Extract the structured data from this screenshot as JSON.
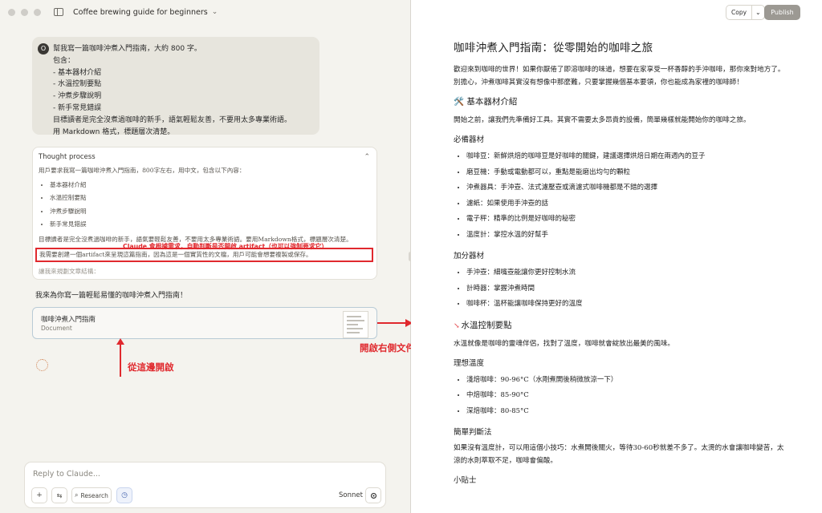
{
  "window": {
    "title": "Coffee brewing guide for beginners"
  },
  "chat": {
    "user_avatar": "O",
    "user_message_lines": [
      "幫我寫一篇咖啡沖煮入門指南，大約 800 字。",
      "包含：",
      "- 基本器材介紹",
      "- 水溫控制要點",
      "- 沖煮步驟說明",
      "- 新手常見錯誤",
      "目標讀者是完全沒煮過咖啡的新手，語氣輕鬆友善，不要用太多專業術語。",
      "用 Markdown 格式，標題層次清楚。"
    ],
    "thought_process": {
      "label": "Thought process",
      "intro": "用戶要求我寫一篇咖啡沖煮入門指南，800字左右，用中文，包含以下內容：",
      "items": [
        "基本器材介紹",
        "水溫控制要點",
        "沖煮步驟說明",
        "新手常見錯誤"
      ],
      "note": "目標讀者是完全沒煮過咖啡的新手，語氣要輕鬆友善，不要用太多專業術語。要用Markdown格式，標題層次清楚。",
      "highlighted": "我需要創建一個artifact來呈現這篇指南，因為這是一個實質性的文檔，用戶可能會想要複製或保存。",
      "faded": "讓我來規劃文章結構："
    },
    "assistant_reply": "我來為你寫一篇輕鬆易懂的咖啡沖煮入門指南！",
    "artifact_card": {
      "title": "咖啡沖煮入門指南",
      "type": "Document"
    },
    "composer": {
      "placeholder": "Reply to Claude...",
      "research_label": "Research",
      "model": "Sonnet 4"
    }
  },
  "annotations": {
    "auto_artifact": "Claude 會根據需求，自動判斷是否開啟 artifact（也可以強制要求它）",
    "open_from_here": "從這邊開啟",
    "open_right_panel": "開啟右側文件版面"
  },
  "toolbar": {
    "copy_label": "Copy",
    "publish_label": "Publish"
  },
  "document": {
    "title": "咖啡沖煮入門指南：從零開始的咖啡之旅",
    "intro": "歡迎來到咖啡的世界！如果你厭倦了即溶咖啡的味道，想要在家享受一杯香醇的手沖咖啡，那你來對地方了。別擔心，沖煮咖啡其實沒有想像中那麼難，只要掌握幾個基本要領，你也能成為家裡的咖啡師！",
    "section1": {
      "heading": "🛠️ 基本器材介紹",
      "intro": "開始之前，讓我們先準備好工具。其實不需要太多昂貴的設備，簡單幾樣就能開始你的咖啡之旅。",
      "sub1": {
        "heading": "必備器材",
        "items": [
          "咖啡豆：新鮮烘焙的咖啡豆是好咖啡的關鍵，建議選擇烘焙日期在兩週內的豆子",
          "磨豆機：手動或電動都可以，重點是能磨出均勻的顆粒",
          "沖煮器具：手沖壺、法式濾壓壺或滴濾式咖啡機都是不錯的選擇",
          "濾紙：如果使用手沖壺的話",
          "電子秤：精準的比例是好咖啡的秘密",
          "溫度計：掌控水溫的好幫手"
        ]
      },
      "sub2": {
        "heading": "加分器材",
        "items": [
          "手沖壺：細嘴壺能讓你更好控制水流",
          "計時器：掌握沖煮時間",
          "咖啡杯：溫杯能讓咖啡保持更好的溫度"
        ]
      }
    },
    "section2": {
      "heading": "水溫控制要點",
      "intro": "水溫就像是咖啡的靈魂伴侶，找對了溫度，咖啡就會綻放出最美的風味。",
      "sub1": {
        "heading": "理想溫度",
        "items": [
          "淺焙咖啡：90-96°C（水剛煮開後稍微放涼一下）",
          "中焙咖啡：85-90°C",
          "深焙咖啡：80-85°C"
        ]
      },
      "sub2": {
        "heading": "簡單判斷法",
        "text": "如果沒有溫度計，可以用這個小技巧：水煮開後關火，等待30-60秒就差不多了。太燙的水會讓咖啡變苦，太涼的水則萃取不足，咖啡會偏酸。"
      },
      "next_heading": "小貼士"
    }
  },
  "colors": {
    "annotation_red": "#e0292e",
    "chat_bg": "#f4f3ee",
    "publish_bg": "#9c9993"
  }
}
